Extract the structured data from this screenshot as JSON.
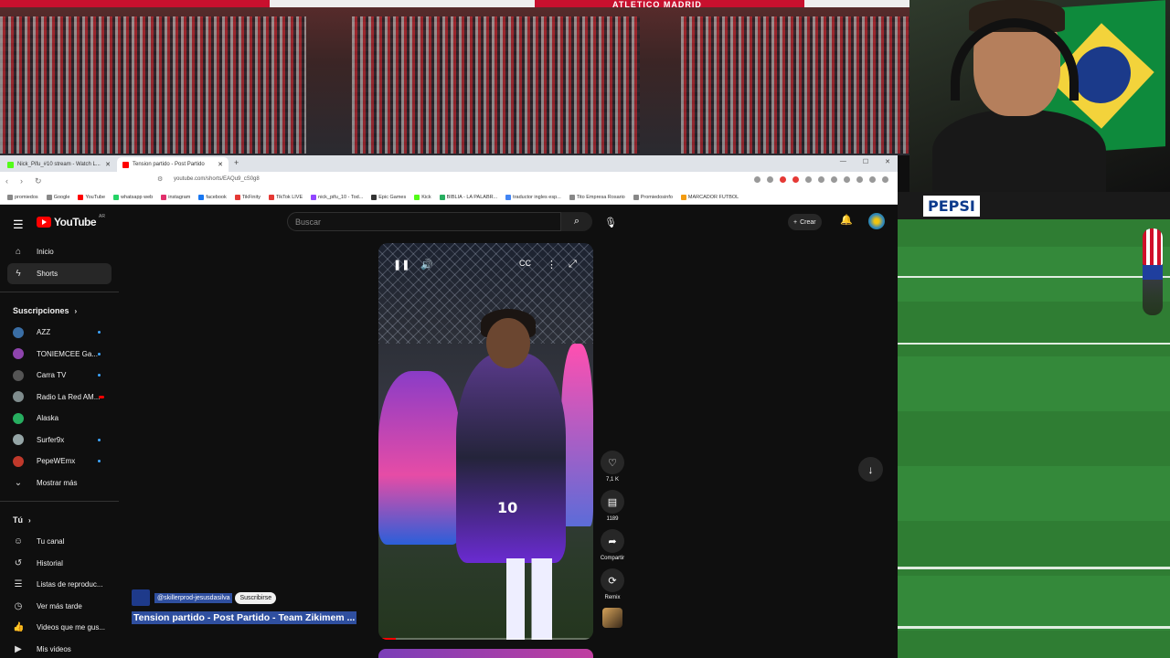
{
  "stadium": {
    "sponsor_text": "ATLETICO MADRID"
  },
  "webcam_overlay": {
    "brand": "PEPSI"
  },
  "browser": {
    "tabs": [
      {
        "label": "Nick_Pifu_#10 stream - Watch L...",
        "active": false
      },
      {
        "label": "Tension partido - Post Partido",
        "active": true
      }
    ],
    "url": "youtube.com/shorts/EAQu9_cS0g8",
    "bookmarks": [
      "promiedos",
      "Google",
      "YouTube",
      "whatsapp web",
      "instagram",
      "facebook",
      "TikFinity",
      "TikTok LIVE",
      "nick_pifu_10 - Tod...",
      "Epic Games",
      "Kick",
      "BIBLIA - LA PALABR...",
      "traductor ingles esp...",
      "Tito Empresa Rosario",
      "Promiedosinfo",
      "MARCADOR FUTBOL"
    ]
  },
  "youtube": {
    "logo_text": "YouTube",
    "country": "AR",
    "search_placeholder": "Buscar",
    "create_label": "Crear",
    "nav": [
      {
        "label": "Inicio",
        "icon": "home-icon"
      },
      {
        "label": "Shorts",
        "icon": "shorts-icon"
      }
    ],
    "subscriptions_heading": "Suscripciones",
    "subscriptions": [
      {
        "label": "AZZ",
        "color": "#3a6ea5"
      },
      {
        "label": "TONIEMCEE Ga...",
        "color": "#8e44ad"
      },
      {
        "label": "Carra TV",
        "color": "#555555"
      },
      {
        "label": "Radio La Red AM...",
        "color": "#7f8c8d",
        "live": true
      },
      {
        "label": "Alaska",
        "color": "#27ae60"
      },
      {
        "label": "Surfer9x",
        "color": "#95a5a6"
      },
      {
        "label": "PepeWEmx",
        "color": "#c0392b"
      }
    ],
    "show_more": "Mostrar más",
    "you_heading": "Tú",
    "you_items": [
      {
        "label": "Tu canal",
        "icon": "channel-icon"
      },
      {
        "label": "Historial",
        "icon": "history-icon"
      },
      {
        "label": "Listas de reproduc...",
        "icon": "playlists-icon"
      },
      {
        "label": "Ver más tarde",
        "icon": "watch-later-icon"
      },
      {
        "label": "Videos que me gus...",
        "icon": "like-icon"
      },
      {
        "label": "Mis videos",
        "icon": "my-videos-icon"
      }
    ],
    "short": {
      "channel": "@skillerprod-jesusdasilva",
      "subscribe_label": "Suscribirse",
      "title": "Tension partido - Post Partido - Team Zikimem ...",
      "jersey_number": "10",
      "progress": 0.08,
      "likes": "7,1 K",
      "comments": "1189",
      "share_label": "Compartir",
      "remix_label": "Remix"
    }
  }
}
